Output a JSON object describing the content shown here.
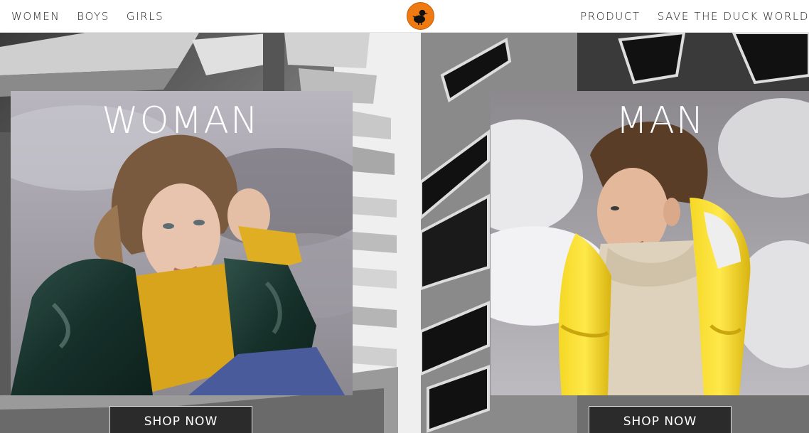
{
  "nav": {
    "left": [
      "WOMEN",
      "BOYS",
      "GIRLS"
    ],
    "right": [
      "PRODUCT",
      "SAVE THE DUCK WORLD"
    ]
  },
  "logo": {
    "icon": "duck-logo-icon",
    "color": "#f07a12"
  },
  "panels": [
    {
      "title": "WOMAN",
      "cta": "SHOP NOW"
    },
    {
      "title": "MAN",
      "cta": "SHOP NOW"
    }
  ],
  "colors": {
    "accent_yellow": "#f2d21b",
    "jacket_green": "#1f3b34",
    "button_bg": "#2b2b2b"
  }
}
